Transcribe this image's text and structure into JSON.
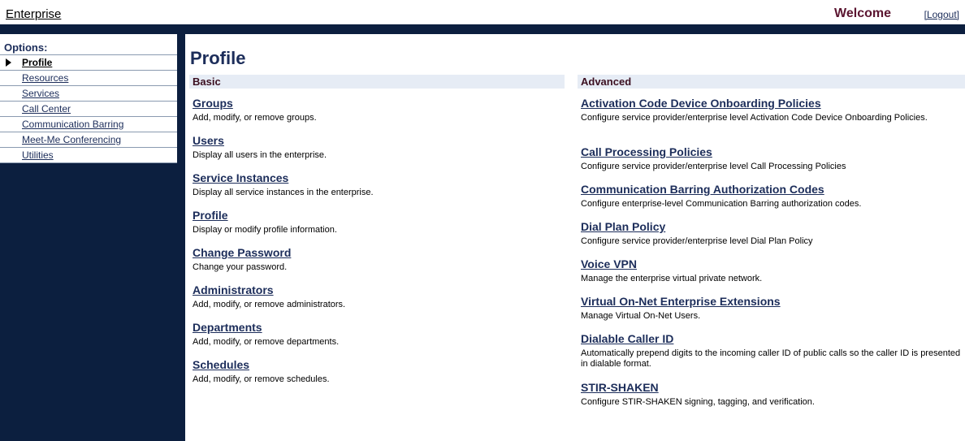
{
  "header": {
    "enterprise_link": "Enterprise",
    "welcome": "Welcome",
    "logout": "[Logout]"
  },
  "sidebar": {
    "title": "Options:",
    "items": [
      {
        "label": "Profile",
        "active": true
      },
      {
        "label": "Resources"
      },
      {
        "label": "Services"
      },
      {
        "label": "Call Center"
      },
      {
        "label": "Communication Barring"
      },
      {
        "label": "Meet-Me Conferencing"
      },
      {
        "label": "Utilities"
      }
    ]
  },
  "main": {
    "title": "Profile",
    "basic": {
      "heading": "Basic",
      "items": [
        {
          "title": "Groups",
          "desc": "Add, modify, or remove groups."
        },
        {
          "title": "Users",
          "desc": "Display all users in the enterprise."
        },
        {
          "title": "Service Instances",
          "desc": "Display all service instances in the enterprise."
        },
        {
          "title": "Profile",
          "desc": "Display or modify profile information."
        },
        {
          "title": "Change Password",
          "desc": "Change your password."
        },
        {
          "title": "Administrators",
          "desc": "Add, modify, or remove administrators."
        },
        {
          "title": "Departments",
          "desc": "Add, modify, or remove departments."
        },
        {
          "title": "Schedules",
          "desc": "Add, modify, or remove schedules."
        }
      ]
    },
    "advanced": {
      "heading": "Advanced",
      "items": [
        {
          "title": "Activation Code Device Onboarding Policies",
          "desc": "Configure service provider/enterprise level Activation Code Device Onboarding Policies."
        },
        {
          "title": "Call Processing Policies",
          "desc": "Configure service provider/enterprise level Call Processing Policies"
        },
        {
          "title": "Communication Barring Authorization Codes",
          "desc": "Configure enterprise-level Communication Barring authorization codes."
        },
        {
          "title": "Dial Plan Policy",
          "desc": "Configure service provider/enterprise level Dial Plan Policy"
        },
        {
          "title": "Voice VPN",
          "desc": "Manage the enterprise virtual private network."
        },
        {
          "title": "Virtual On-Net Enterprise Extensions",
          "desc": "Manage Virtual On-Net Users."
        },
        {
          "title": "Dialable Caller ID",
          "desc": "Automatically prepend digits to the incoming caller ID of public calls so the caller ID is presented in dialable format."
        },
        {
          "title": "STIR-SHAKEN",
          "desc": "Configure STIR-SHAKEN signing, tagging, and verification."
        }
      ]
    }
  }
}
